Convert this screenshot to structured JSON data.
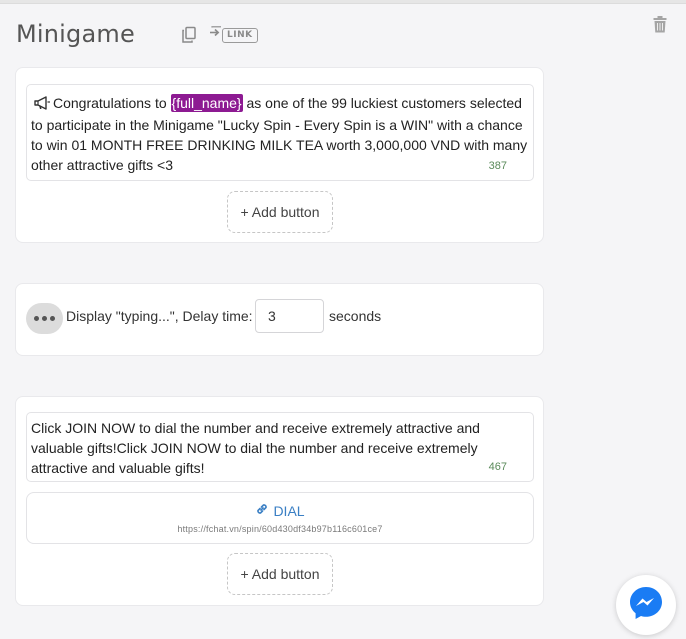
{
  "header": {
    "title": "Minigame",
    "link_label": "LINK"
  },
  "colors": {
    "tag_background": "#8d1a92",
    "dial_link": "#3a7fc4",
    "char_count": "#5a8a5a",
    "messenger_blue": "#1a7cf4"
  },
  "icons": [
    "copy-icon",
    "link-icon",
    "trash-icon",
    "megaphone-icon",
    "typing-dots-icon",
    "chain-link-icon",
    "messenger-icon"
  ],
  "text_block_1": {
    "before_tag": "Congratulations to ",
    "tag": "{full_name}",
    "after_tag": " as one of the 99 luckiest customers selected to participate in the Minigame \"Lucky Spin - Every Spin is a WIN\" with a chance to win 01 MONTH FREE DRINKING MILK TEA worth 3,000,000 VND with many other attractive gifts <3",
    "char_count": "387",
    "add_button_label": "+ Add button"
  },
  "typing_block": {
    "label": "Display \"typing...\", Delay time:",
    "delay_value": "3",
    "unit_label": "seconds"
  },
  "text_block_2": {
    "text": "Click JOIN NOW to dial the number and receive extremely attractive and valuable gifts!Click JOIN NOW to dial the number and receive extremely attractive and valuable gifts!",
    "char_count": "467",
    "dial_button": {
      "label": "DIAL",
      "url": "https://fchat.vn/spin/60d430df34b97b116c601ce7"
    },
    "add_button_label": "+ Add button"
  }
}
